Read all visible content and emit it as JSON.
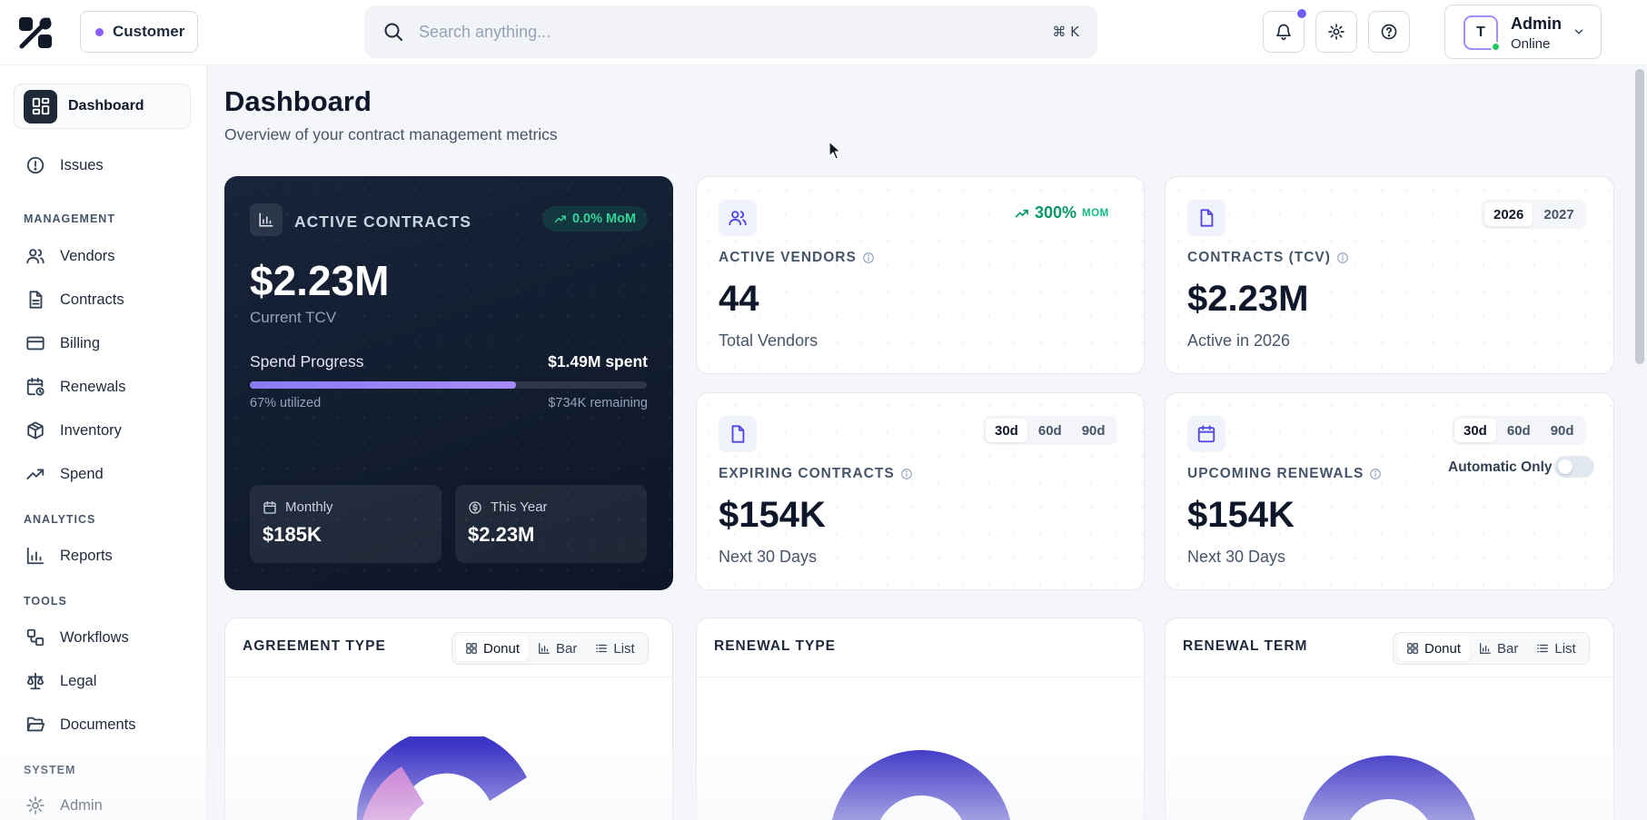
{
  "header": {
    "customer_label": "Customer",
    "search_placeholder": "Search anything...",
    "search_shortcut": "⌘ K",
    "user": {
      "initial": "T",
      "name": "Admin",
      "status": "Online"
    }
  },
  "sidebar": {
    "active": "Dashboard",
    "top_items": [
      "Issues"
    ],
    "sections": [
      {
        "label": "MANAGEMENT",
        "items": [
          "Vendors",
          "Contracts",
          "Billing",
          "Renewals",
          "Inventory",
          "Spend"
        ]
      },
      {
        "label": "ANALYTICS",
        "items": [
          "Reports"
        ]
      },
      {
        "label": "TOOLS",
        "items": [
          "Workflows",
          "Legal",
          "Documents"
        ]
      },
      {
        "label": "SYSTEM",
        "items": [
          "Admin"
        ]
      }
    ]
  },
  "page": {
    "title": "Dashboard",
    "subtitle": "Overview of your contract management metrics"
  },
  "active_contracts": {
    "title": "ACTIVE CONTRACTS",
    "badge": "0.0% MoM",
    "value": "$2.23M",
    "sub": "Current TCV",
    "progress_label": "Spend Progress",
    "spent": "$1.49M spent",
    "progress_pct": 67,
    "utilized": "67% utilized",
    "remaining": "$734K remaining",
    "monthly_label": "Monthly",
    "monthly_value": "$185K",
    "year_label": "This Year",
    "year_value": "$2.23M"
  },
  "active_vendors": {
    "trend": "300%",
    "trend_unit": "MOM",
    "label": "ACTIVE VENDORS",
    "value": "44",
    "sub": "Total Vendors"
  },
  "contracts_tcv": {
    "years": [
      "2026",
      "2027"
    ],
    "active_year": "2026",
    "label": "CONTRACTS (TCV)",
    "value": "$2.23M",
    "sub": "Active in 2026"
  },
  "expiring_contracts": {
    "ranges": [
      "30d",
      "60d",
      "90d"
    ],
    "active_range": "30d",
    "label": "EXPIRING CONTRACTS",
    "value": "$154K",
    "sub": "Next 30 Days"
  },
  "upcoming_renewals": {
    "ranges": [
      "30d",
      "60d",
      "90d"
    ],
    "active_range": "30d",
    "toggle_label": "Automatic Only",
    "toggle_on": false,
    "label": "UPCOMING RENEWALS",
    "value": "$154K",
    "sub": "Next 30 Days"
  },
  "charts": {
    "agreement_type": {
      "title": "AGREEMENT TYPE",
      "views": [
        "Donut",
        "Bar",
        "List"
      ],
      "active_view": "Donut",
      "colors": [
        "#c46fd0",
        "#3d35c6"
      ]
    },
    "renewal_type": {
      "title": "RENEWAL TYPE",
      "colors": [
        "#3d35c6"
      ]
    },
    "renewal_term": {
      "title": "RENEWAL TERM",
      "views": [
        "Donut",
        "Bar",
        "List"
      ],
      "active_view": "Donut",
      "colors": [
        "#3d35c6"
      ]
    }
  },
  "colors": {
    "accent": "#6d5ff3",
    "dark_card": "#0f1a2b",
    "success": "#10b981"
  }
}
